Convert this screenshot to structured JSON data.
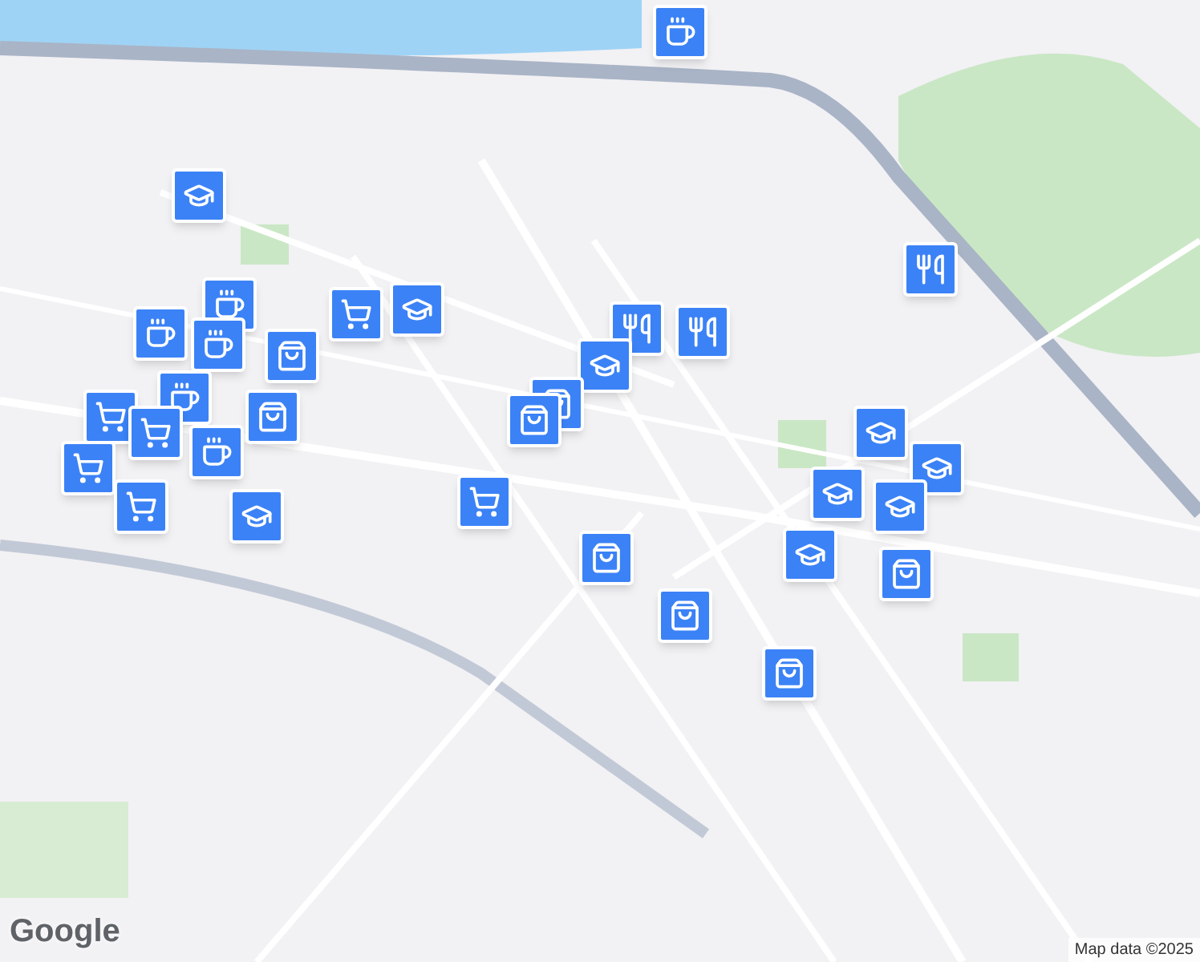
{
  "map": {
    "markers": [
      {
        "kind": "cafe"
      },
      {
        "kind": "school"
      },
      {
        "kind": "cafe"
      },
      {
        "kind": "cart"
      },
      {
        "kind": "school"
      },
      {
        "kind": "cafe"
      },
      {
        "kind": "cafe"
      },
      {
        "kind": "bag"
      },
      {
        "kind": "cart"
      },
      {
        "kind": "cafe"
      },
      {
        "kind": "cart"
      },
      {
        "kind": "cart"
      },
      {
        "kind": "cafe"
      },
      {
        "kind": "bag"
      },
      {
        "kind": "cart"
      },
      {
        "kind": "school"
      },
      {
        "kind": "restaurant"
      },
      {
        "kind": "restaurant"
      },
      {
        "kind": "school"
      },
      {
        "kind": "bag"
      },
      {
        "kind": "bag"
      },
      {
        "kind": "cart"
      },
      {
        "kind": "bag"
      },
      {
        "kind": "bag"
      },
      {
        "kind": "restaurant"
      },
      {
        "kind": "school"
      },
      {
        "kind": "school"
      },
      {
        "kind": "school"
      },
      {
        "kind": "school"
      },
      {
        "kind": "school"
      },
      {
        "kind": "bag"
      },
      {
        "kind": "bag"
      }
    ]
  },
  "logo": "Google",
  "attribution": "Map data ©2025"
}
